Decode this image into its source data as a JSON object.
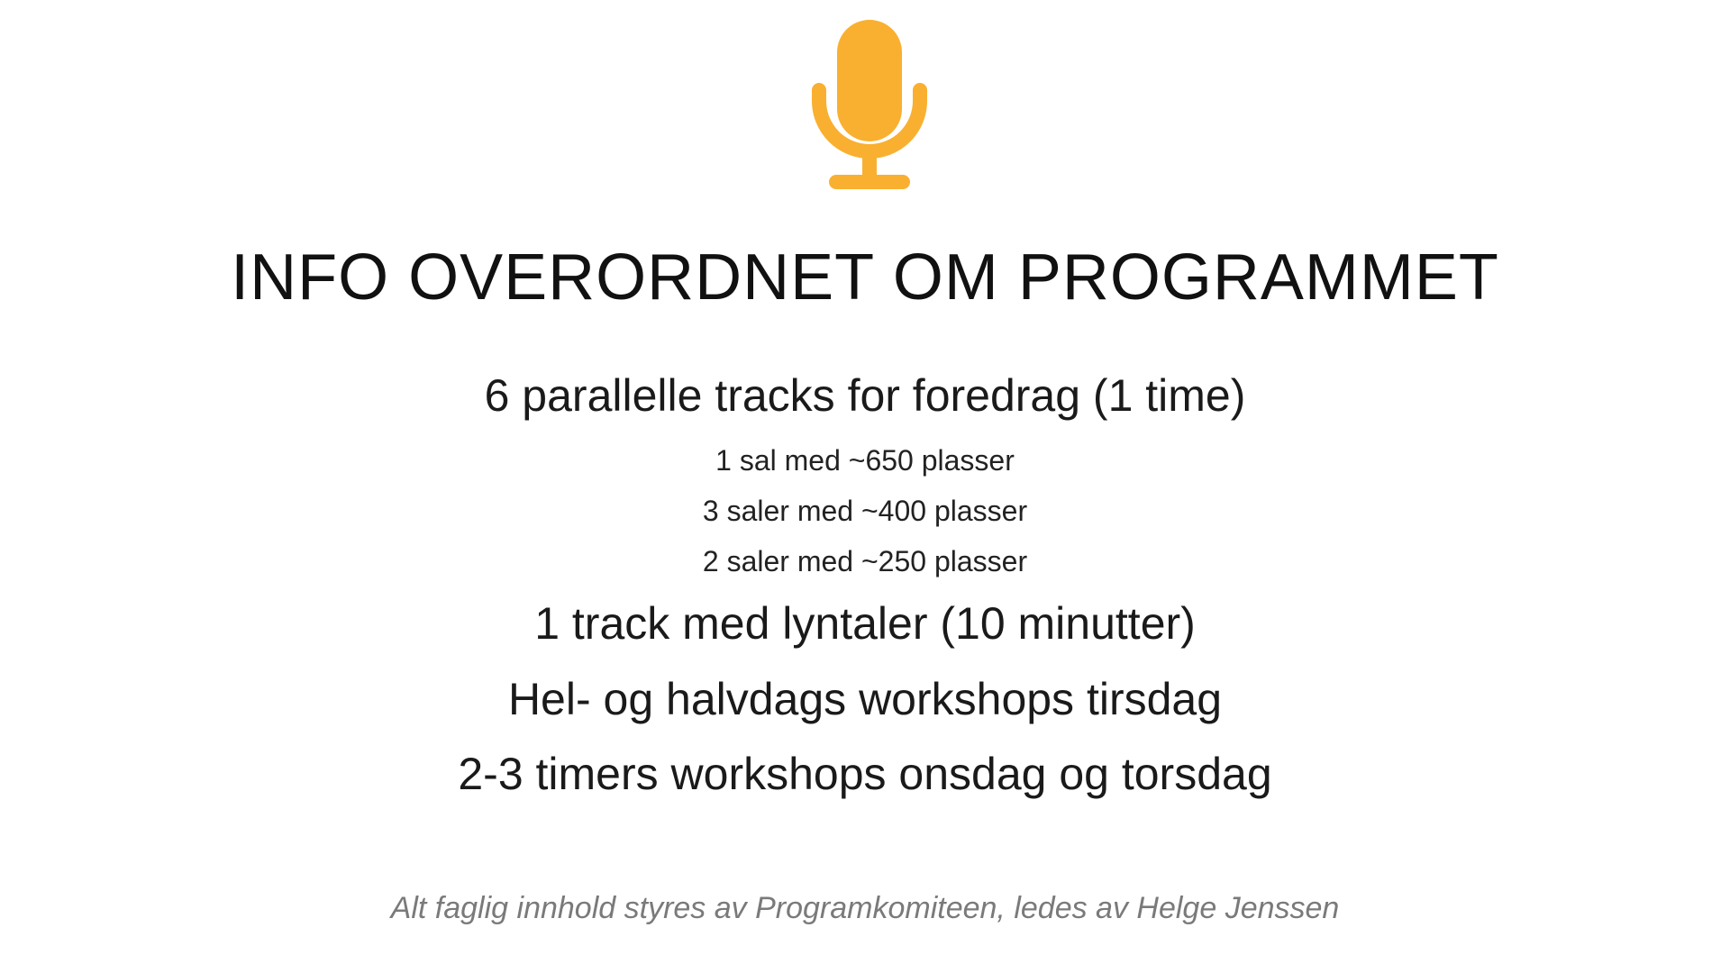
{
  "slide": {
    "icon": "microphone-icon",
    "accent_color": "#F9B030",
    "title": "INFO OVERORDNET OM PROGRAMMET",
    "items": [
      "6 parallelle tracks for foredrag (1 time)",
      "1 sal med ~650 plasser",
      "3 saler med ~400 plasser",
      "2 saler med ~250 plasser",
      "1 track med lyntaler (10 minutter)",
      "Hel- og halvdags workshops tirsdag",
      "2-3 timers workshops onsdag og torsdag"
    ],
    "footer": "Alt faglig innhold styres av Programkomiteen, ledes av Helge Jenssen"
  }
}
